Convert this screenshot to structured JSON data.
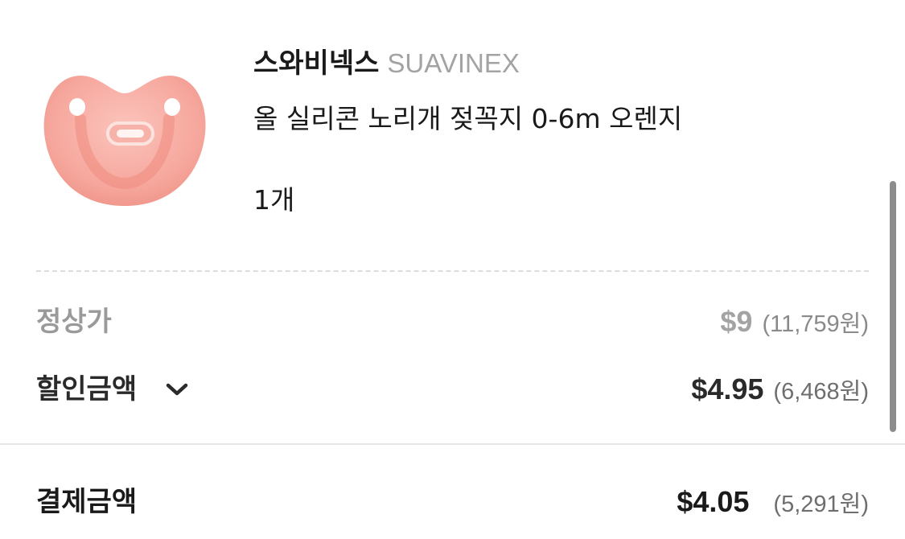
{
  "product": {
    "brand_ko": "스와비넥스",
    "brand_en": "SUAVINEX",
    "name": "올 실리콘 노리개 젖꼭지 0-6m 오렌지",
    "quantity": "1개",
    "image_icon": "pacifier-icon"
  },
  "pricing": {
    "regular": {
      "label": "정상가",
      "usd": "$9",
      "krw": "(11,759원)"
    },
    "discount": {
      "label": "할인금액",
      "usd": "$4.95",
      "krw": "(6,468원)",
      "toggle_icon": "chevron-down-icon"
    },
    "payment": {
      "label": "결제금액",
      "usd": "$4.05",
      "krw": "(5,291원)"
    }
  },
  "colors": {
    "text_primary": "#1a1a1a",
    "text_muted": "#a3a3a3",
    "divider": "#e6e6e6",
    "pacifier": "#f4a39a"
  }
}
